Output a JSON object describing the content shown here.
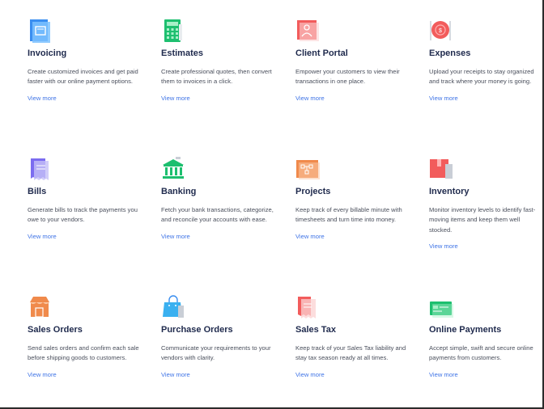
{
  "features": [
    {
      "key": "invoicing",
      "title": "Invoicing",
      "desc": "Create customized invoices and get paid faster with our online payment options.",
      "link": "View more",
      "icon": "invoice-icon"
    },
    {
      "key": "estimates",
      "title": "Estimates",
      "desc": "Create professional quotes, then convert them to invoices in a click.",
      "link": "View more",
      "icon": "calculator-icon"
    },
    {
      "key": "client-portal",
      "title": "Client Portal",
      "desc": "Empower your customers to view their transactions in one place.",
      "link": "View more",
      "icon": "portal-icon"
    },
    {
      "key": "expenses",
      "title": "Expenses",
      "desc": "Upload your receipts to stay organized and track where your money is going.",
      "link": "View more",
      "icon": "plate-icon"
    },
    {
      "key": "bills",
      "title": "Bills",
      "desc": "Generate bills to track the payments you owe to your vendors.",
      "link": "View more",
      "icon": "bill-icon"
    },
    {
      "key": "banking",
      "title": "Banking",
      "desc": "Fetch your bank transactions, categorize, and reconcile your accounts with ease.",
      "link": "View more",
      "icon": "bank-icon"
    },
    {
      "key": "projects",
      "title": "Projects",
      "desc": "Keep track of every billable minute with timesheets and turn time into money.",
      "link": "View more",
      "icon": "project-board-icon"
    },
    {
      "key": "inventory",
      "title": "Inventory",
      "desc": "Monitor inventory levels to identify fast-moving items and keep them well stocked.",
      "link": "View more",
      "icon": "box-icon"
    },
    {
      "key": "sales-orders",
      "title": "Sales Orders",
      "desc": "Send sales orders and confirm each sale before shipping goods to customers.",
      "link": "View more",
      "icon": "store-icon"
    },
    {
      "key": "purchase-orders",
      "title": "Purchase Orders",
      "desc": "Communicate your requirements to your vendors with clarity.",
      "link": "View more",
      "icon": "shopping-bag-icon"
    },
    {
      "key": "sales-tax",
      "title": "Sales Tax",
      "desc": "Keep track of your Sales Tax liability and stay tax season ready at all times.",
      "link": "View more",
      "icon": "tax-receipt-icon"
    },
    {
      "key": "online-payments",
      "title": "Online Payments",
      "desc": "Accept simple, swift and secure online payments from customers.",
      "link": "View more",
      "icon": "credit-card-icon"
    }
  ],
  "colors": {
    "title": "#1f2a4d",
    "text": "#4a4f5c",
    "link": "#3f74e6"
  }
}
